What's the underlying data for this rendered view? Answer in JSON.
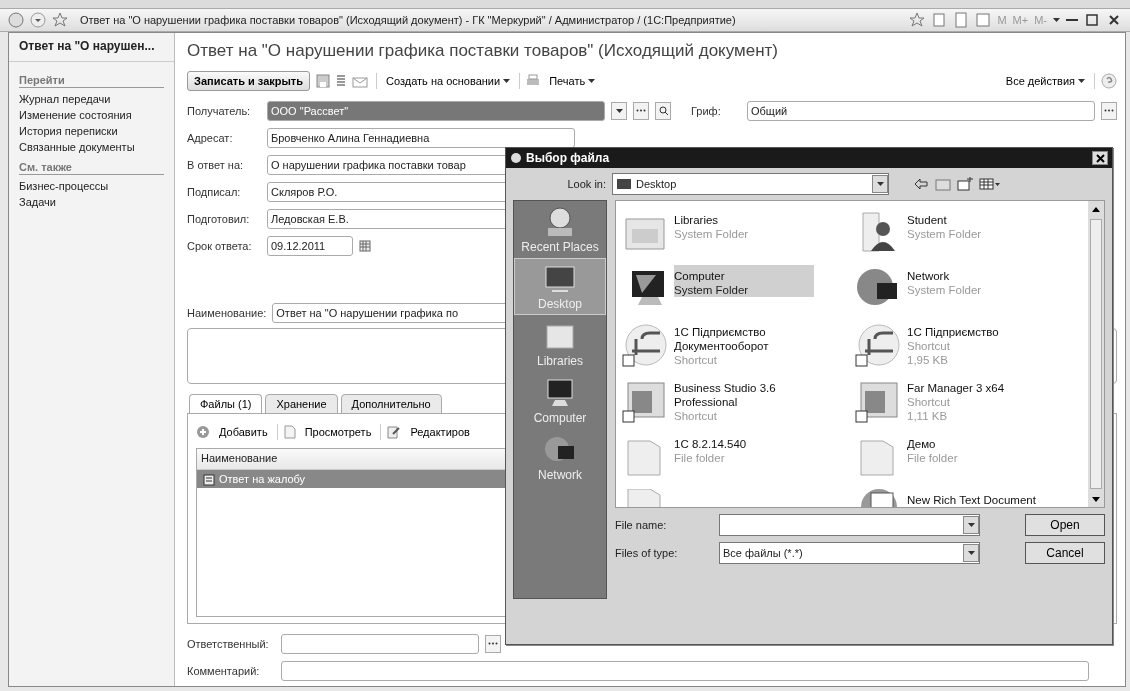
{
  "window": {
    "title": "Ответ на \"О нарушении графика поставки товаров\" (Исходящий документ) - ГК \"Меркурий\" / Администратор /  (1С:Предприятие)",
    "memory_buttons": [
      "M",
      "M+",
      "M-"
    ]
  },
  "sidebar": {
    "heading": "Ответ на \"О нарушен...",
    "sections": [
      {
        "title": "Перейти",
        "items": [
          "Журнал передачи",
          "Изменение состояния",
          "История переписки",
          "Связанные документы"
        ]
      },
      {
        "title": "См. также",
        "items": [
          "Бизнес-процессы",
          "Задачи"
        ]
      }
    ]
  },
  "form": {
    "title": "Ответ на \"О нарушении графика поставки товаров\" (Исходящий документ)",
    "toolbar": {
      "save_close": "Записать и закрыть",
      "create_based_on": "Создать на основании",
      "print": "Печать",
      "all_actions": "Все действия"
    },
    "fields": [
      {
        "kind": "choice",
        "label": "Получатель:",
        "value": "ООО \"Рассвет\"",
        "selected": true
      },
      {
        "kind": "text",
        "label": "Адресат:",
        "value": "Бровченко Алина Геннадиевна",
        "selected": false
      },
      {
        "kind": "text",
        "label": "В ответ на:",
        "value": "О нарушении графика поставки товар",
        "selected": false
      },
      {
        "kind": "text",
        "label": "Подписал:",
        "value": "Скляров Р.О.",
        "selected": false
      },
      {
        "kind": "text",
        "label": "Подготовил:",
        "value": "Ледовская Е.В.",
        "selected": false
      },
      {
        "kind": "date",
        "label": "Срок ответа:",
        "value": "09.12.2011",
        "selected": false
      }
    ],
    "classification": {
      "label": "Гриф:",
      "value": "Общий"
    },
    "name_field": {
      "label": "Наименование:",
      "value": "Ответ на \"О нарушении графика по"
    },
    "tabs": [
      {
        "label": "Файлы (1)",
        "selected": true
      },
      {
        "label": "Хранение",
        "selected": false
      },
      {
        "label": "Дополнительно",
        "selected": false
      }
    ],
    "files_toolbar": [
      {
        "kind": "add",
        "label": "Добавить"
      },
      {
        "kind": "view",
        "label": "Просмотреть"
      },
      {
        "kind": "edit",
        "label": "Редактиров"
      }
    ],
    "files_table": {
      "columns": [
        "Наименование"
      ],
      "rows": [
        {
          "name": "Ответ на жалобу",
          "selected": true
        }
      ]
    },
    "responsible": {
      "label": "Ответственный:"
    },
    "comment": {
      "label": "Комментарий:"
    }
  },
  "dialog": {
    "title": "Выбор файла",
    "look_in": {
      "label": "Look in:",
      "value": "Desktop"
    },
    "places": [
      {
        "kind": "recent",
        "label": "Recent Places",
        "selected": false
      },
      {
        "kind": "desktop",
        "label": "Desktop",
        "selected": true
      },
      {
        "kind": "libraries",
        "label": "Libraries",
        "selected": false
      },
      {
        "kind": "computer",
        "label": "Computer",
        "selected": false
      },
      {
        "kind": "network",
        "label": "Network",
        "selected": false
      }
    ],
    "files": [
      {
        "kind": "libraries",
        "lines": [
          "Libraries"
        ],
        "details": [
          "System Folder"
        ],
        "selected": false
      },
      {
        "kind": "user",
        "lines": [
          "Student"
        ],
        "details": [
          "System Folder"
        ],
        "selected": false
      },
      {
        "kind": "computer",
        "lines": [
          "Computer"
        ],
        "details": [
          "System Folder"
        ],
        "selected": true
      },
      {
        "kind": "network",
        "lines": [
          "Network"
        ],
        "details": [
          "System Folder"
        ],
        "selected": false
      },
      {
        "kind": "logo",
        "lines": [
          "1С Підприємство",
          "Документооборот"
        ],
        "details": [
          "Shortcut"
        ],
        "selected": false
      },
      {
        "kind": "logo",
        "lines": [
          "1С Підприємство"
        ],
        "details": [
          "Shortcut",
          "1,95 KB"
        ],
        "selected": false
      },
      {
        "kind": "app",
        "lines": [
          "Business Studio 3.6",
          "Professional"
        ],
        "details": [
          "Shortcut"
        ],
        "selected": false
      },
      {
        "kind": "app",
        "lines": [
          "Far Manager 3 x64"
        ],
        "details": [
          "Shortcut",
          "1,11 KB"
        ],
        "selected": false
      },
      {
        "kind": "folder",
        "lines": [
          "1С 8.2.14.540"
        ],
        "details": [
          "File folder"
        ],
        "selected": false
      },
      {
        "kind": "folder",
        "lines": [
          "Демо"
        ],
        "details": [
          "File folder"
        ],
        "selected": false
      },
      {
        "kind": "folder"
      },
      {
        "kind": "document",
        "lines": [
          "New Rich Text Document"
        ],
        "selected": false
      }
    ],
    "file_name": {
      "label": "File name:"
    },
    "file_type": {
      "label": "Files of type:",
      "value": "Все файлы (*.*)"
    },
    "buttons": [
      "Open",
      "Cancel"
    ]
  }
}
